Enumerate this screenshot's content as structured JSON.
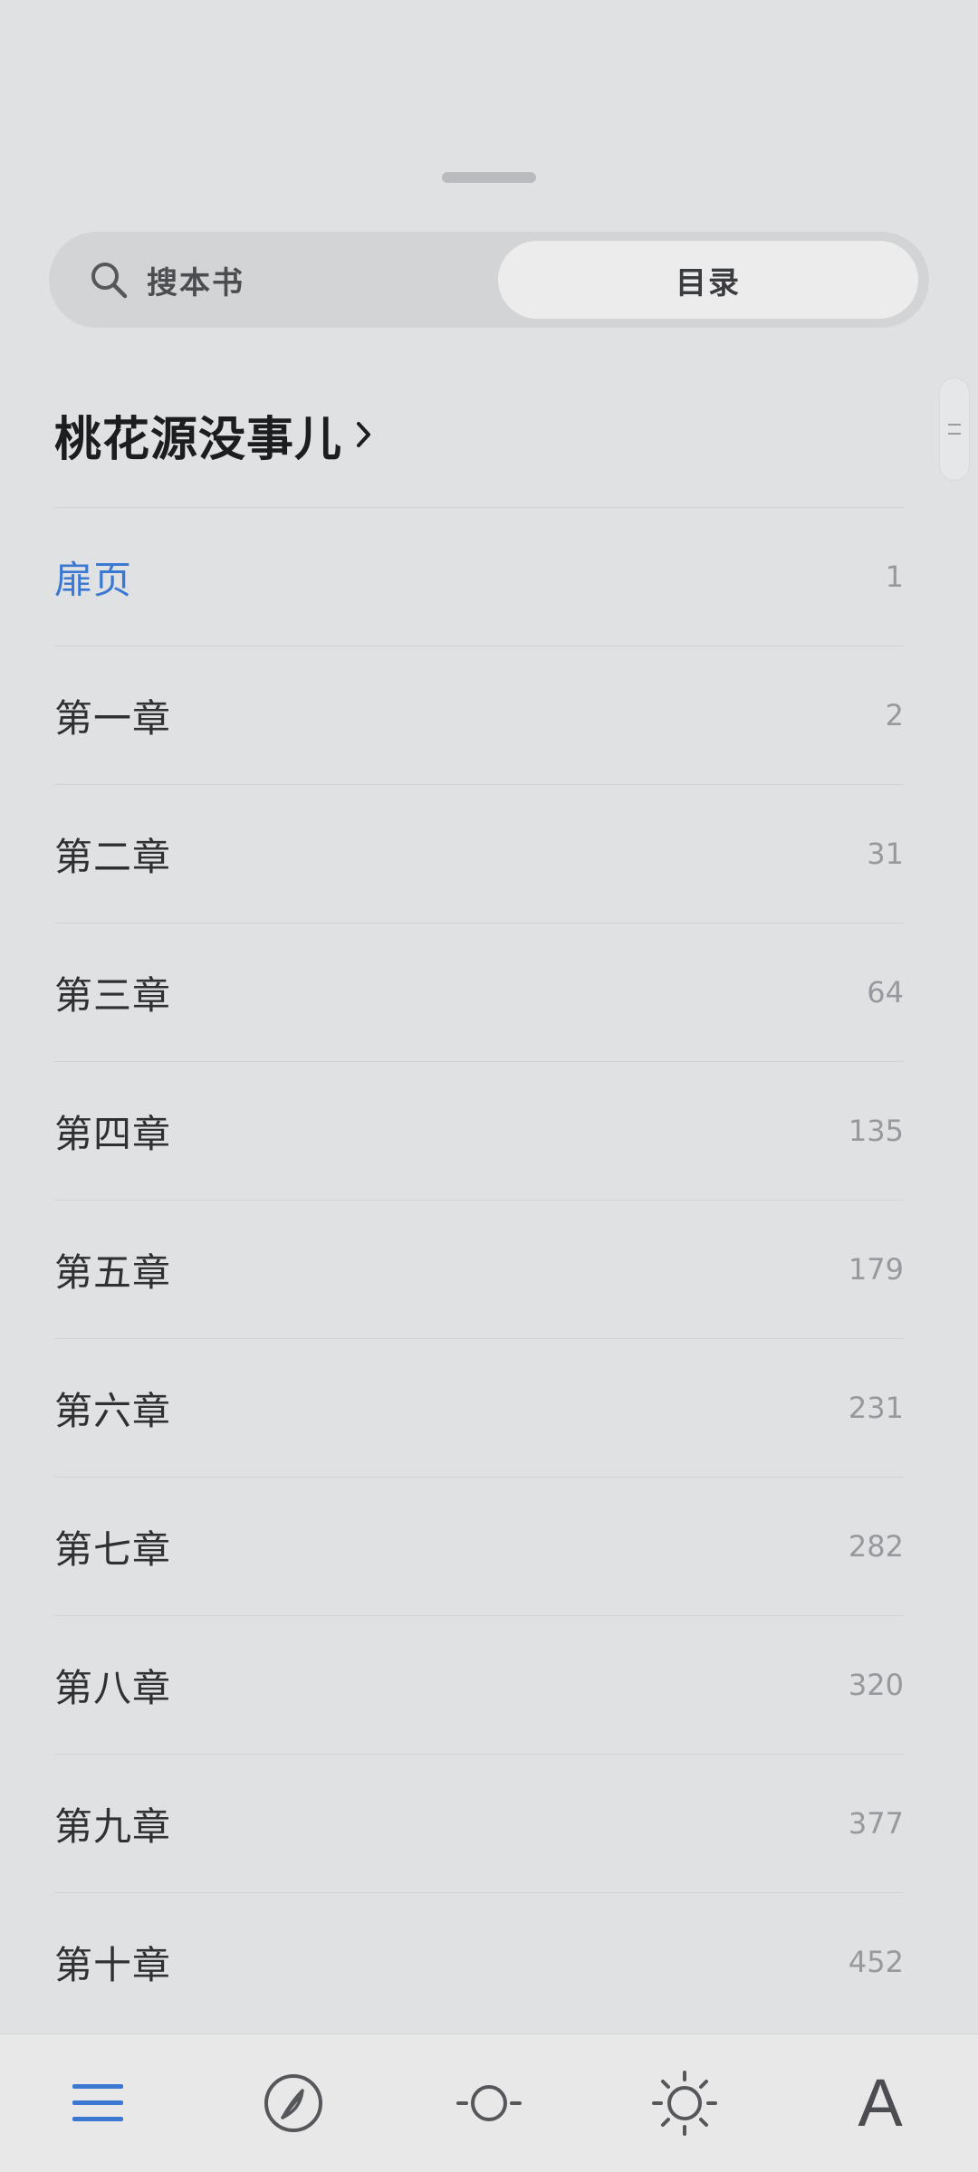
{
  "segmented": {
    "search_label": "搜本书",
    "toc_label": "目录",
    "search_icon": "search-icon"
  },
  "book": {
    "title": "桃花源没事儿"
  },
  "toc": {
    "items": [
      {
        "label": "扉页",
        "page": "1",
        "active": true
      },
      {
        "label": "第一章",
        "page": "2"
      },
      {
        "label": "第二章",
        "page": "31"
      },
      {
        "label": "第三章",
        "page": "64"
      },
      {
        "label": "第四章",
        "page": "135"
      },
      {
        "label": "第五章",
        "page": "179"
      },
      {
        "label": "第六章",
        "page": "231"
      },
      {
        "label": "第七章",
        "page": "282"
      },
      {
        "label": "第八章",
        "page": "320"
      },
      {
        "label": "第九章",
        "page": "377"
      },
      {
        "label": "第十章",
        "page": "452"
      }
    ]
  },
  "bottom_bar": {
    "items": [
      {
        "icon": "menu-icon",
        "active": true
      },
      {
        "icon": "compass-icon"
      },
      {
        "icon": "brightness-low-icon"
      },
      {
        "icon": "brightness-high-icon"
      },
      {
        "icon": "font-icon",
        "label": "A"
      }
    ]
  },
  "colors": {
    "accent": "#3a78d2",
    "background": "#e0e1e3",
    "text_primary": "#2e3033",
    "text_secondary": "#96999d"
  }
}
